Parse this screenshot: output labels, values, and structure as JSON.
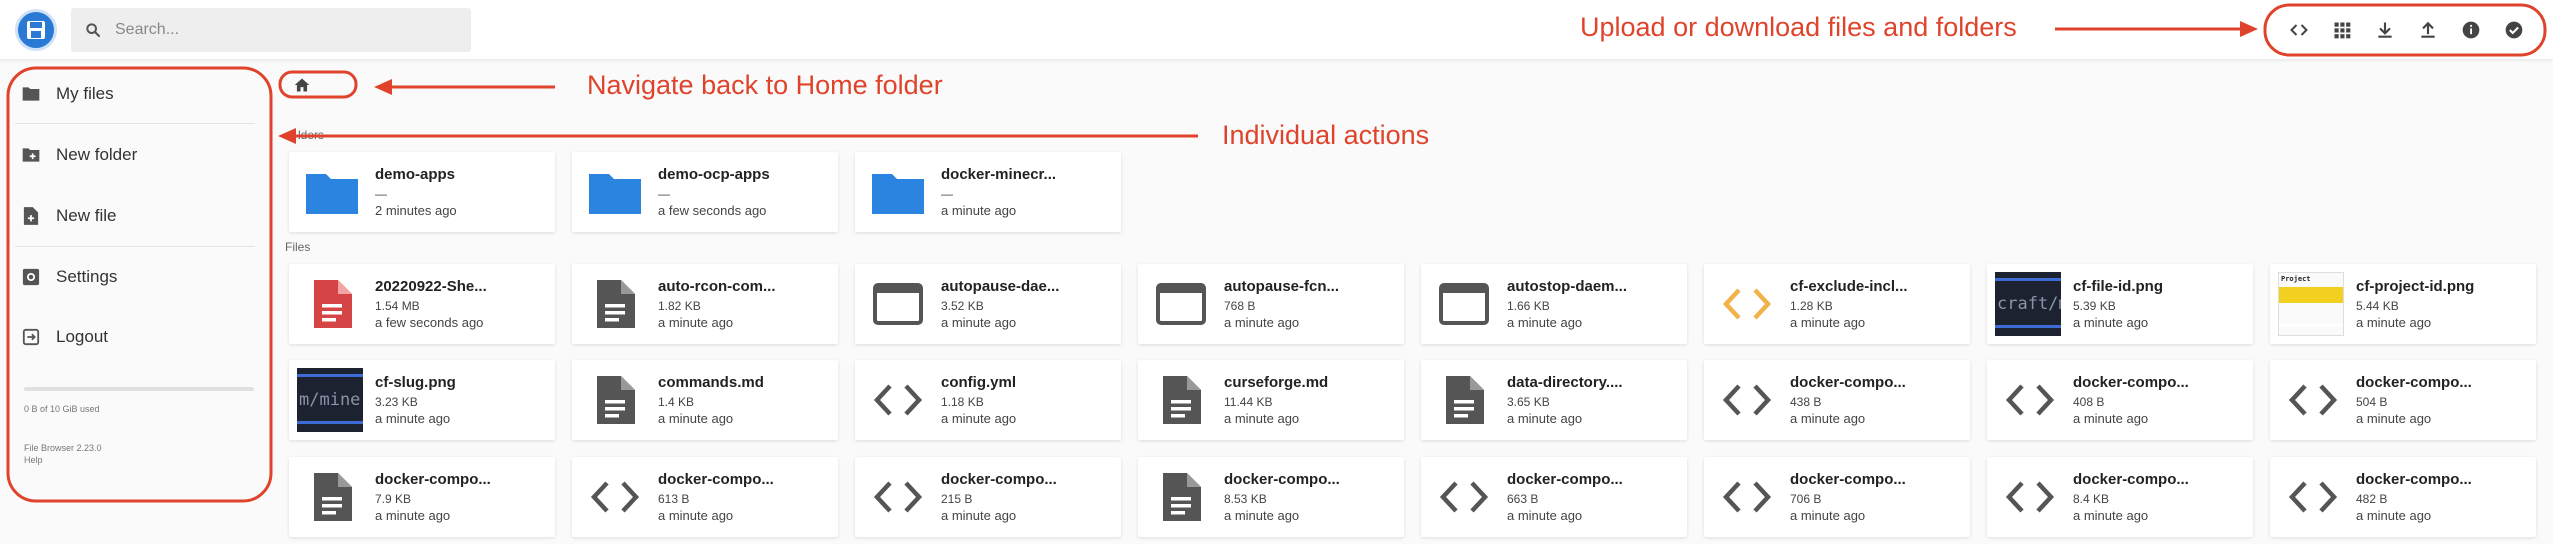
{
  "app": {
    "search_placeholder": "Search...",
    "brand_color": "#2979d5"
  },
  "header": {
    "actions": [
      {
        "icon": "code-icon",
        "label": "Switch view"
      },
      {
        "icon": "grid-icon",
        "label": "Grid view"
      },
      {
        "icon": "download-icon",
        "label": "Download"
      },
      {
        "icon": "upload-icon",
        "label": "Upload"
      },
      {
        "icon": "info-icon",
        "label": "Info"
      },
      {
        "icon": "check-circle-icon",
        "label": "Select multiple"
      }
    ]
  },
  "sidebar": {
    "items": [
      {
        "icon": "folder-icon",
        "label": "My files"
      },
      {
        "icon": "create-folder-icon",
        "label": "New folder"
      },
      {
        "icon": "new-file-icon",
        "label": "New file"
      },
      {
        "icon": "settings-icon",
        "label": "Settings"
      },
      {
        "icon": "logout-icon",
        "label": "Logout"
      }
    ],
    "quota": "0 B of 10 GiB used",
    "version": "File Browser 2.23.0",
    "help": "Help"
  },
  "main": {
    "breadcrumb_icon": "home-icon",
    "folders_label": "lders",
    "files_label": "Files",
    "folders": [
      {
        "name": "demo-apps",
        "size": "—",
        "modified": "2 minutes ago"
      },
      {
        "name": "demo-ocp-apps",
        "size": "—",
        "modified": "a few seconds ago"
      },
      {
        "name": "docker-minecr...",
        "size": "—",
        "modified": "a minute ago"
      }
    ],
    "files": [
      {
        "name": "20220922-She...",
        "size": "1.54 MB",
        "modified": "a few seconds ago",
        "icon": "pdf"
      },
      {
        "name": "auto-rcon-com...",
        "size": "1.82 KB",
        "modified": "a minute ago",
        "icon": "doc"
      },
      {
        "name": "autopause-dae...",
        "size": "3.52 KB",
        "modified": "a minute ago",
        "icon": "window"
      },
      {
        "name": "autopause-fcn...",
        "size": "768 B",
        "modified": "a minute ago",
        "icon": "window"
      },
      {
        "name": "autostop-daem...",
        "size": "1.66 KB",
        "modified": "a minute ago",
        "icon": "window"
      },
      {
        "name": "cf-exclude-incl...",
        "size": "1.28 KB",
        "modified": "a minute ago",
        "icon": "code-orange"
      },
      {
        "name": "cf-file-id.png",
        "size": "5.39 KB",
        "modified": "a minute ago",
        "icon": "img-dark",
        "thumb_text": "craft/m"
      },
      {
        "name": "cf-project-id.png",
        "size": "5.44 KB",
        "modified": "a minute ago",
        "icon": "img-light",
        "thumb_text": "Project"
      },
      {
        "name": "cf-slug.png",
        "size": "3.23 KB",
        "modified": "a minute ago",
        "icon": "img-dark",
        "thumb_text": "m/mine"
      },
      {
        "name": "commands.md",
        "size": "1.4 KB",
        "modified": "a minute ago",
        "icon": "doc"
      },
      {
        "name": "config.yml",
        "size": "1.18 KB",
        "modified": "a minute ago",
        "icon": "code"
      },
      {
        "name": "curseforge.md",
        "size": "11.44 KB",
        "modified": "a minute ago",
        "icon": "doc"
      },
      {
        "name": "data-directory....",
        "size": "3.65 KB",
        "modified": "a minute ago",
        "icon": "doc"
      },
      {
        "name": "docker-compo...",
        "size": "438 B",
        "modified": "a minute ago",
        "icon": "code"
      },
      {
        "name": "docker-compo...",
        "size": "408 B",
        "modified": "a minute ago",
        "icon": "code"
      },
      {
        "name": "docker-compo...",
        "size": "504 B",
        "modified": "a minute ago",
        "icon": "code"
      },
      {
        "name": "docker-compo...",
        "size": "7.9 KB",
        "modified": "a minute ago",
        "icon": "doc"
      },
      {
        "name": "docker-compo...",
        "size": "613 B",
        "modified": "a minute ago",
        "icon": "code"
      },
      {
        "name": "docker-compo...",
        "size": "215 B",
        "modified": "a minute ago",
        "icon": "code"
      },
      {
        "name": "docker-compo...",
        "size": "8.53 KB",
        "modified": "a minute ago",
        "icon": "doc"
      },
      {
        "name": "docker-compo...",
        "size": "663 B",
        "modified": "a minute ago",
        "icon": "code"
      },
      {
        "name": "docker-compo...",
        "size": "706 B",
        "modified": "a minute ago",
        "icon": "code"
      },
      {
        "name": "docker-compo...",
        "size": "8.4 KB",
        "modified": "a minute ago",
        "icon": "code"
      },
      {
        "name": "docker-compo...",
        "size": "482 B",
        "modified": "a minute ago",
        "icon": "code"
      }
    ]
  },
  "annotations": {
    "upload_text": "Upload or download files and folders",
    "home_text": "Navigate back to Home folder",
    "actions_text": "Individual actions",
    "color": "#e0432c"
  }
}
